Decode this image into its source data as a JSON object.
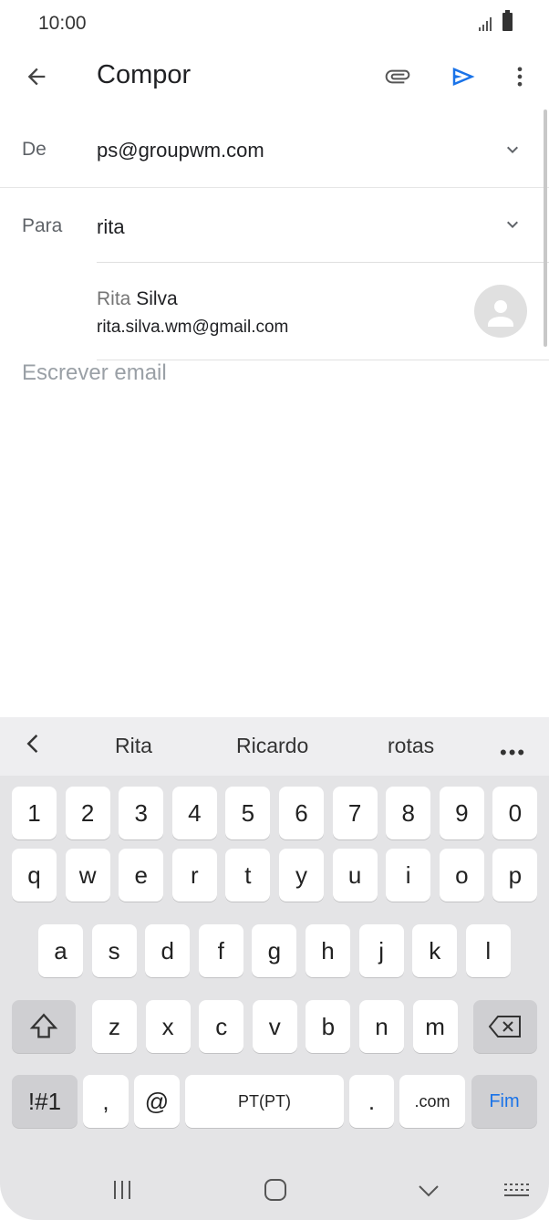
{
  "status_bar": {
    "time": "10:00"
  },
  "app_bar": {
    "title": "Compor"
  },
  "from": {
    "label": "De",
    "value": "ps@groupwm.com"
  },
  "to": {
    "label": "Para",
    "value": "rita"
  },
  "suggestion": {
    "name_match": "Rita",
    "name_rest": " Silva",
    "email": "rita.silva.wm@gmail.com"
  },
  "body": {
    "placeholder": "Escrever email"
  },
  "keyboard": {
    "predictions": [
      "Rita",
      "Ricardo",
      "rotas"
    ],
    "more": "•••",
    "row_numbers": [
      "1",
      "2",
      "3",
      "4",
      "5",
      "6",
      "7",
      "8",
      "9",
      "0"
    ],
    "row_q": [
      "q",
      "w",
      "e",
      "r",
      "t",
      "y",
      "u",
      "i",
      "o",
      "p"
    ],
    "row_a": [
      "a",
      "s",
      "d",
      "f",
      "g",
      "h",
      "j",
      "k",
      "l"
    ],
    "row_z": [
      "z",
      "x",
      "c",
      "v",
      "b",
      "n",
      "m"
    ],
    "symbols_key": "!#1",
    "comma_key": ",",
    "at_key": "@",
    "space_label": "PT(PT)",
    "period_key": ".",
    "dotcom_key": ".com",
    "done_key": "Fim"
  },
  "colors": {
    "accent": "#1a73e8",
    "keyboard_bg": "#e4e4e6"
  }
}
